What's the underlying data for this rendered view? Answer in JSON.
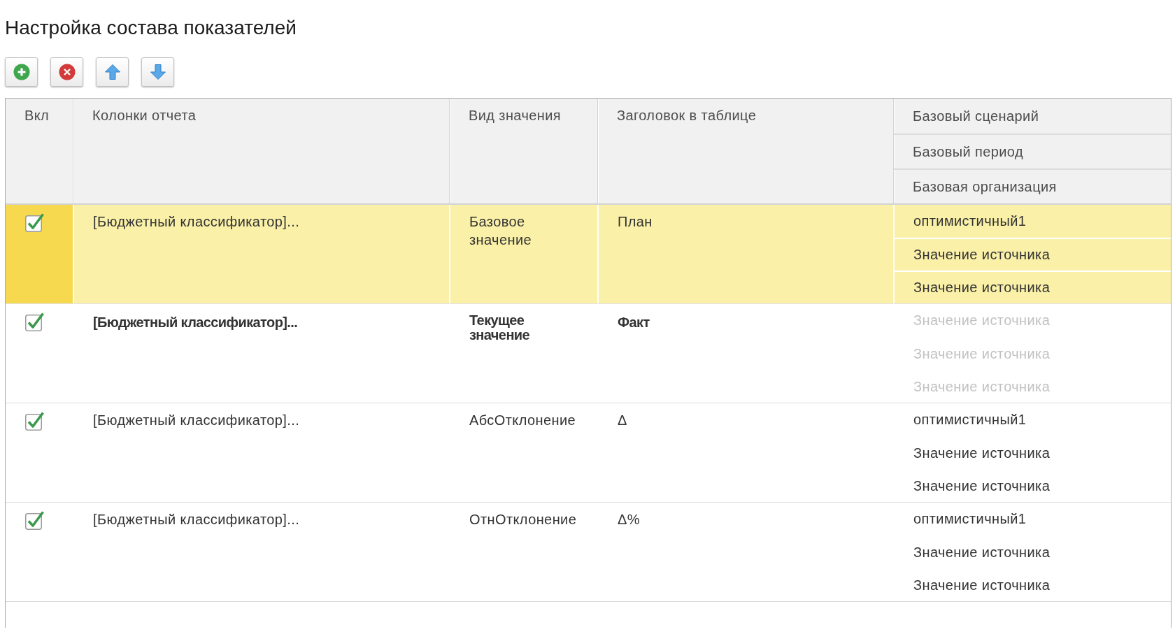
{
  "title": "Настройка состава показателей",
  "toolbar": [
    {
      "kind": "add"
    },
    {
      "kind": "delete"
    },
    {
      "kind": "up"
    },
    {
      "kind": "down"
    }
  ],
  "table": {
    "columns": [
      "Вкл",
      "Колонки отчета",
      "Вид значения",
      "Заголовок в таблице"
    ],
    "base_columns": [
      "Базовый сценарий",
      "Базовый период",
      "Базовая организация"
    ],
    "rows": [
      {
        "selected": true,
        "checked": true,
        "bold": false,
        "report_column": "[Бюджетный классификатор]...",
        "value_kind": "Базовое значение",
        "table_heading": "План",
        "base_values": [
          {
            "text": "оптимистичный1",
            "disabled": false
          },
          {
            "text": "Значение источника",
            "disabled": false
          },
          {
            "text": "Значение источника",
            "disabled": false
          }
        ]
      },
      {
        "selected": false,
        "checked": true,
        "bold": true,
        "report_column": "[Бюджетный классификатор]...",
        "value_kind": "Текущее значение",
        "table_heading": "Факт",
        "base_values": [
          {
            "text": "Значение источника",
            "disabled": true
          },
          {
            "text": "Значение источника",
            "disabled": true
          },
          {
            "text": "Значение источника",
            "disabled": true
          }
        ]
      },
      {
        "selected": false,
        "checked": true,
        "bold": false,
        "report_column": "[Бюджетный классификатор]...",
        "value_kind": "АбсОтклонение",
        "table_heading": "Δ",
        "base_values": [
          {
            "text": "оптимистичный1",
            "disabled": false
          },
          {
            "text": "Значение источника",
            "disabled": false
          },
          {
            "text": "Значение источника",
            "disabled": false
          }
        ]
      },
      {
        "selected": false,
        "checked": true,
        "bold": false,
        "report_column": "[Бюджетный классификатор]...",
        "value_kind": "ОтнОтклонение",
        "table_heading": "Δ%",
        "base_values": [
          {
            "text": "оптимистичный1",
            "disabled": false
          },
          {
            "text": "Значение источника",
            "disabled": false
          },
          {
            "text": "Значение источника",
            "disabled": false
          }
        ]
      }
    ]
  }
}
